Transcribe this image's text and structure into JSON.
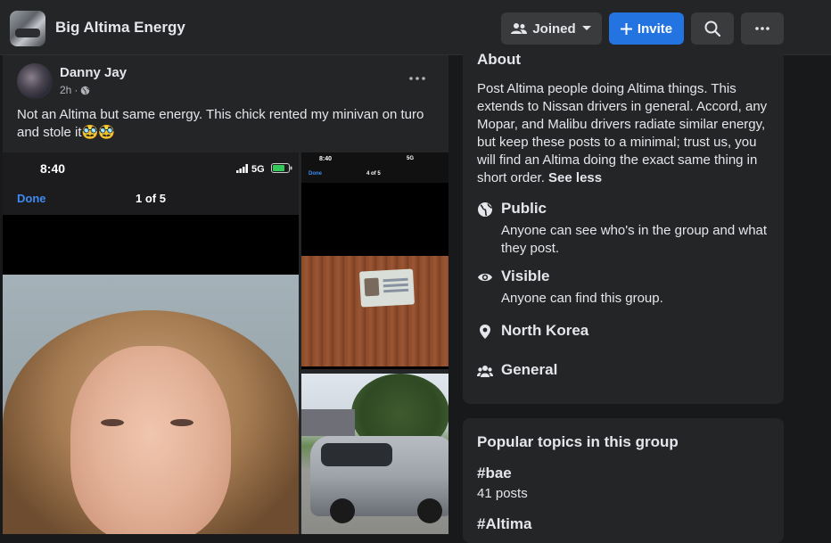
{
  "header": {
    "group_name": "Big Altima Energy",
    "joined_label": "Joined",
    "invite_label": "Invite"
  },
  "post": {
    "author": "Danny Jay",
    "time": "2h",
    "separator": "·",
    "text": "Not an Altima but same energy. This chick rented my minivan on turo and stole it🥸🥸",
    "photo_main": {
      "time": "8:40",
      "network": "5G",
      "done_label": "Done",
      "count_label": "1 of 5"
    },
    "photo_side": {
      "time": "8:40",
      "network": "5G",
      "done_label": "Done",
      "count_label": "4 of 5"
    }
  },
  "about": {
    "title": "About",
    "description": "Post Altima people doing Altima things. This extends to Nissan drivers in general. Accord, any Mopar, and Malibu drivers radiate similar energy, but keep these posts to a minimal; trust us, you will find an Altima doing the exact same thing in short order.",
    "see_less": "See less",
    "items": [
      {
        "label": "Public",
        "sub": "Anyone can see who's in the group and what they post.",
        "icon": "globe-icon"
      },
      {
        "label": "Visible",
        "sub": "Anyone can find this group.",
        "icon": "eye-icon"
      },
      {
        "label": "North Korea",
        "sub": "",
        "icon": "location-pin-icon"
      },
      {
        "label": "General",
        "sub": "",
        "icon": "people-icon"
      }
    ]
  },
  "topics": {
    "title": "Popular topics in this group",
    "tags": [
      {
        "name": "#bae",
        "count": "41 posts"
      },
      {
        "name": "#Altima",
        "count": ""
      }
    ]
  },
  "colors": {
    "background": "#18191a",
    "card": "#242526",
    "button": "#3a3b3c",
    "accent": "#2374e1",
    "text": "#e4e6eb",
    "secondary_text": "#b0b3b8"
  }
}
